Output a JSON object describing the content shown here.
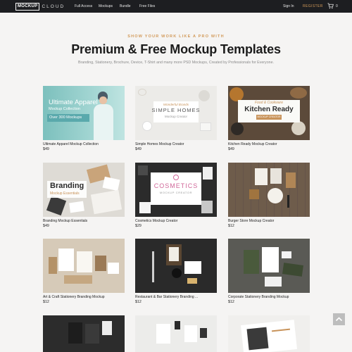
{
  "header": {
    "logo_text": "MOCKUP",
    "logo_suffix": "CLOUD",
    "nav": [
      "Full Access",
      "Mockups",
      "Bundle",
      "Free Files"
    ],
    "signin": "Sign In",
    "register": "REGISTER",
    "cart_count": "0"
  },
  "hero": {
    "eyebrow": "SHOW YOUR WORK LIKE A PRO WITH",
    "title": "Premium & Free Mockup Templates",
    "subtitle": "Branding, Stationery, Brochure, Device, T-Shirt and many more PSD Mockups, Created by Professionals for Everyone."
  },
  "products": [
    {
      "title": "Ultimate Apparel Mockup Collection",
      "price": "$49",
      "overlay": [
        "Ultimate Apparel",
        "Mockup Collection",
        "Over 300 Mockups"
      ]
    },
    {
      "title": "Simple Homes Mockup Creator",
      "price": "$49",
      "overlay": [
        "Wonderful Brands",
        "SIMPLE HOMES",
        "Mockup Creator"
      ]
    },
    {
      "title": "Kitchen Ready Mockup Creator",
      "price": "$49",
      "overlay": [
        "Food & Cookware",
        "Kitchen Ready",
        "MOCKUP CREATOR"
      ]
    },
    {
      "title": "Branding Mockup Essentials",
      "price": "$49",
      "overlay": [
        "Branding",
        "Mockup Essentials"
      ]
    },
    {
      "title": "Cosmetics Mockup Creator",
      "price": "$29",
      "overlay": [
        "COSMETICS",
        "MOCKUP CREATOR"
      ]
    },
    {
      "title": "Burger Store Mockup Creator",
      "price": "$12",
      "overlay": []
    },
    {
      "title": "Art & Craft Stationery Branding Mockup",
      "price": "$12",
      "overlay": []
    },
    {
      "title": "Restaurant & Bar Stationery Branding ...",
      "price": "$12",
      "overlay": []
    },
    {
      "title": "Corporate Stationery Branding Mockup",
      "price": "$12",
      "overlay": []
    },
    {
      "title": "",
      "price": "",
      "overlay": []
    },
    {
      "title": "",
      "price": "",
      "overlay": []
    },
    {
      "title": "",
      "price": "",
      "overlay": []
    }
  ],
  "icons": {
    "cart": "cart-icon",
    "scroll_top": "chevron-up-icon"
  },
  "colors": {
    "topbar": "#1d1e21",
    "accent": "#d29a5a",
    "page_bg": "#f5f4f3"
  }
}
